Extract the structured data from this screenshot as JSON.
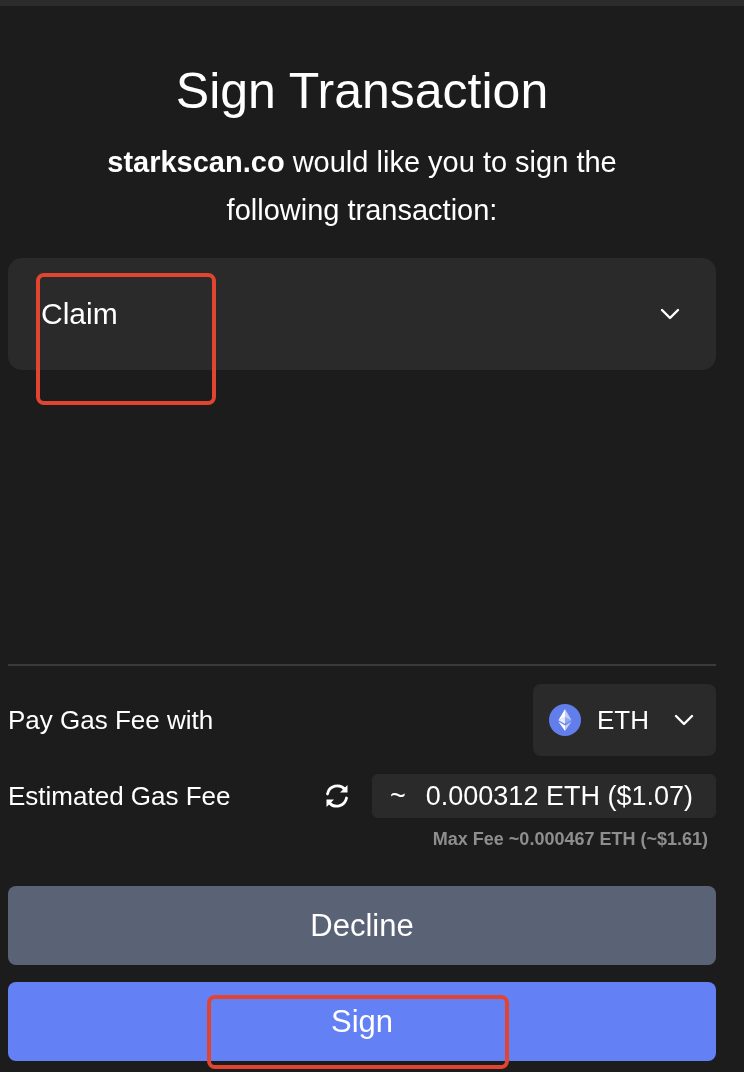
{
  "header": {
    "title": "Sign Transaction",
    "message": "**starkscan.co** would like you to sign the following transaction:"
  },
  "transactions": [
    {
      "label": "Claim",
      "expanded": false,
      "highlighted": true
    }
  ],
  "gas": {
    "pay_label": "Pay Gas Fee with",
    "token": "ETH",
    "estimate_label": "Estimated Gas Fee",
    "approx": "~",
    "amount": "0.000312 ETH ($1.07)",
    "max_fee": "Max Fee ~0.000467 ETH (~$1.61)"
  },
  "buttons": [
    {
      "label": "Decline",
      "kind": "secondary",
      "highlighted": false
    },
    {
      "label": "Sign",
      "kind": "primary",
      "highlighted": true
    }
  ]
}
